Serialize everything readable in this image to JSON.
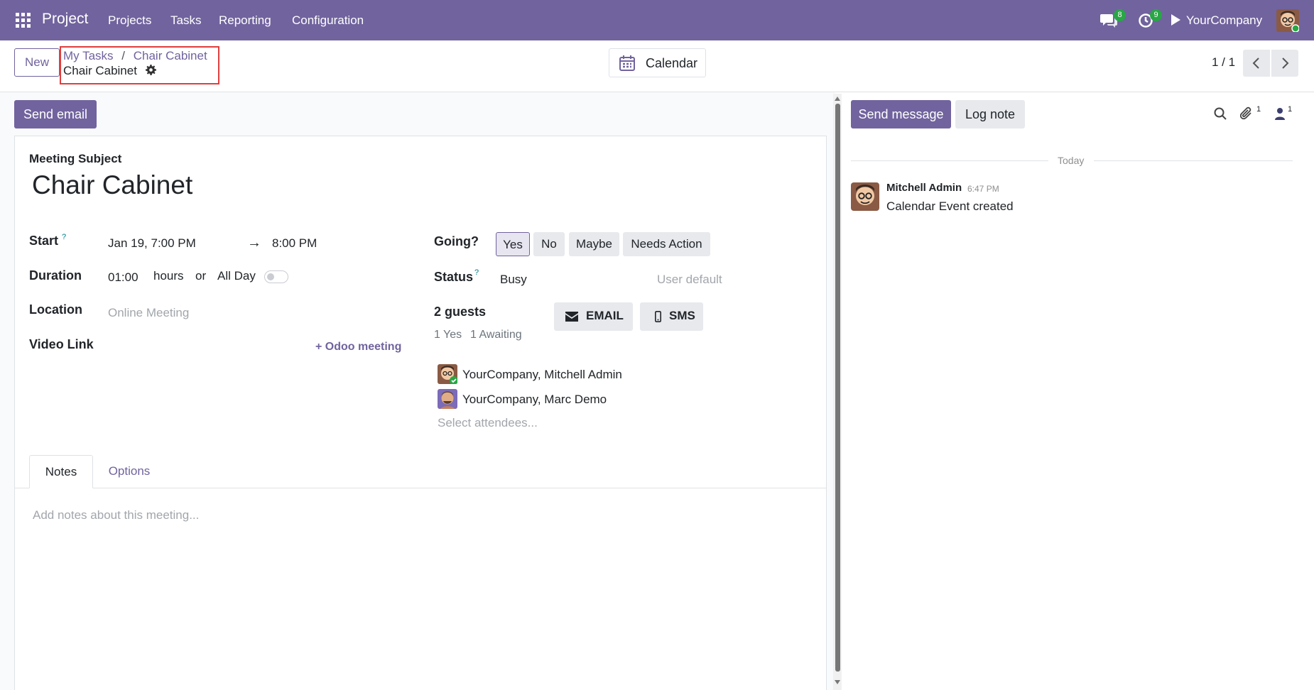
{
  "nav": {
    "app_name": "Project",
    "menus": [
      "Projects",
      "Tasks",
      "Reporting",
      "Configuration"
    ],
    "messages_count": "8",
    "activities_count": "9",
    "company": "YourCompany"
  },
  "control": {
    "new_label": "New",
    "breadcrumb_parent": "My Tasks",
    "breadcrumb_sep": "/",
    "breadcrumb_current_link": "Chair Cabinet",
    "record_title": "Chair Cabinet",
    "calendar_label": "Calendar",
    "pager": "1 / 1"
  },
  "form": {
    "send_email_label": "Send email",
    "subject_label": "Meeting Subject",
    "subject_value": "Chair Cabinet",
    "start_label": "Start",
    "help_mark": "?",
    "start_value": "Jan 19, 7:00 PM",
    "arrow": "→",
    "stop_value": "8:00 PM",
    "duration_label": "Duration",
    "duration_value": "01:00",
    "hours_label": "hours",
    "or_label": "or",
    "allday_label": "All Day",
    "location_label": "Location",
    "location_placeholder": "Online Meeting",
    "video_label": "Video Link",
    "odoo_meeting_label": "Odoo meeting",
    "going_label": "Going?",
    "going_options": [
      "Yes",
      "No",
      "Maybe",
      "Needs Action"
    ],
    "status_label": "Status",
    "status_value": "Busy",
    "status_default": "User default",
    "guests_label": "2 guests",
    "guests_yes": "1 Yes",
    "guests_awaiting": "1 Awaiting",
    "email_btn": "EMAIL",
    "sms_btn": "SMS",
    "attendees": [
      "YourCompany, Mitchell Admin",
      "YourCompany, Marc Demo"
    ],
    "attendee_placeholder": "Select attendees...",
    "tabs": [
      "Notes",
      "Options"
    ],
    "notes_placeholder": "Add notes about this meeting..."
  },
  "chatter": {
    "send_message_label": "Send message",
    "log_note_label": "Log note",
    "attachments_count": "1",
    "followers_count": "1",
    "date_separator": "Today",
    "messages": [
      {
        "author": "Mitchell Admin",
        "time": "6:47 PM",
        "body": "Calendar Event created"
      }
    ]
  },
  "colors": {
    "brand": "#71639e",
    "badge": "#28a745",
    "highlight": "#e03e3e"
  }
}
